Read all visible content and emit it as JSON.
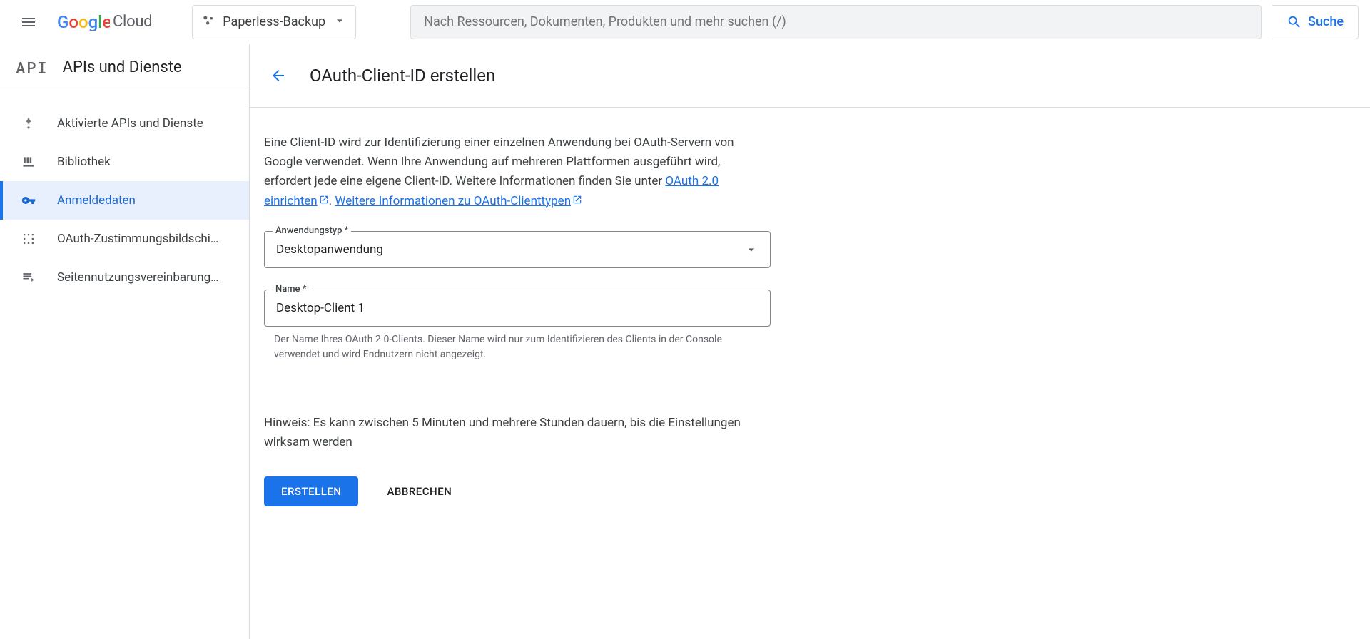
{
  "header": {
    "logo_cloud": "Cloud",
    "project_name": "Paperless-Backup",
    "search_placeholder": "Nach Ressourcen, Dokumenten, Produkten und mehr suchen (/)",
    "search_button": "Suche"
  },
  "sidebar": {
    "badge": "API",
    "title": "APIs und Dienste",
    "items": [
      {
        "label": "Aktivierte APIs und Dienste"
      },
      {
        "label": "Bibliothek"
      },
      {
        "label": "Anmeldedaten"
      },
      {
        "label": "OAuth-Zustimmungsbildschi…"
      },
      {
        "label": "Seitennutzungsvereinbarung…"
      }
    ]
  },
  "page": {
    "title": "OAuth-Client-ID erstellen",
    "intro_part1": "Eine Client-ID wird zur Identifizierung einer einzelnen Anwendung bei OAuth-Servern von Google verwendet. Wenn Ihre Anwendung auf mehreren Plattformen ausgeführt wird, erfordert jede eine eigene Client-ID. Weitere Informationen finden Sie unter ",
    "link1": "OAuth 2.0 einrichten",
    "intro_sep": ". ",
    "link2": "Weitere Informationen zu OAuth-Clienttypen",
    "form": {
      "app_type_label": "Anwendungstyp *",
      "app_type_value": "Desktopanwendung",
      "name_label": "Name *",
      "name_value": "Desktop-Client 1",
      "name_helper": "Der Name Ihres OAuth 2.0-Clients. Dieser Name wird nur zum Identifizieren des Clients in der Console verwendet und wird Endnutzern nicht angezeigt."
    },
    "note": "Hinweis: Es kann zwischen 5 Minuten und mehrere Stunden dauern, bis die Einstellungen wirksam werden",
    "actions": {
      "create": "ERSTELLEN",
      "cancel": "ABBRECHEN"
    }
  }
}
